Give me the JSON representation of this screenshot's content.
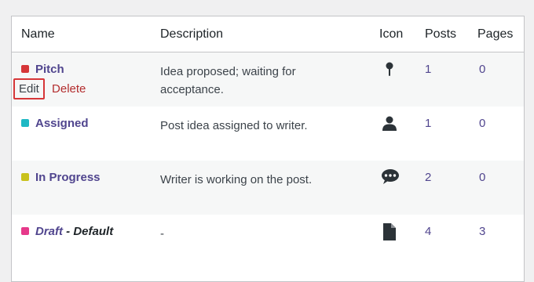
{
  "columns": {
    "name": "Name",
    "description": "Description",
    "icon": "Icon",
    "posts": "Posts",
    "pages": "Pages"
  },
  "rows": [
    {
      "name": "Pitch",
      "suffix": "",
      "color": "#d63638",
      "description": "Idea proposed; waiting for acceptance.",
      "icon": "pin-icon",
      "posts": "1",
      "pages": "0",
      "actions": {
        "edit": "Edit",
        "delete": "Delete"
      }
    },
    {
      "name": "Assigned",
      "suffix": "",
      "color": "#1eb8c4",
      "description": "Post idea assigned to writer.",
      "icon": "user-icon",
      "posts": "1",
      "pages": "0"
    },
    {
      "name": "In Progress",
      "suffix": "",
      "color": "#c9c21c",
      "description": "Writer is working on the post.",
      "icon": "speech-bubble-icon",
      "posts": "2",
      "pages": "0"
    },
    {
      "name": "Draft",
      "suffix": " - Default",
      "color": "#e6398a",
      "description": "-",
      "icon": "document-icon",
      "posts": "4",
      "pages": "3"
    }
  ]
}
